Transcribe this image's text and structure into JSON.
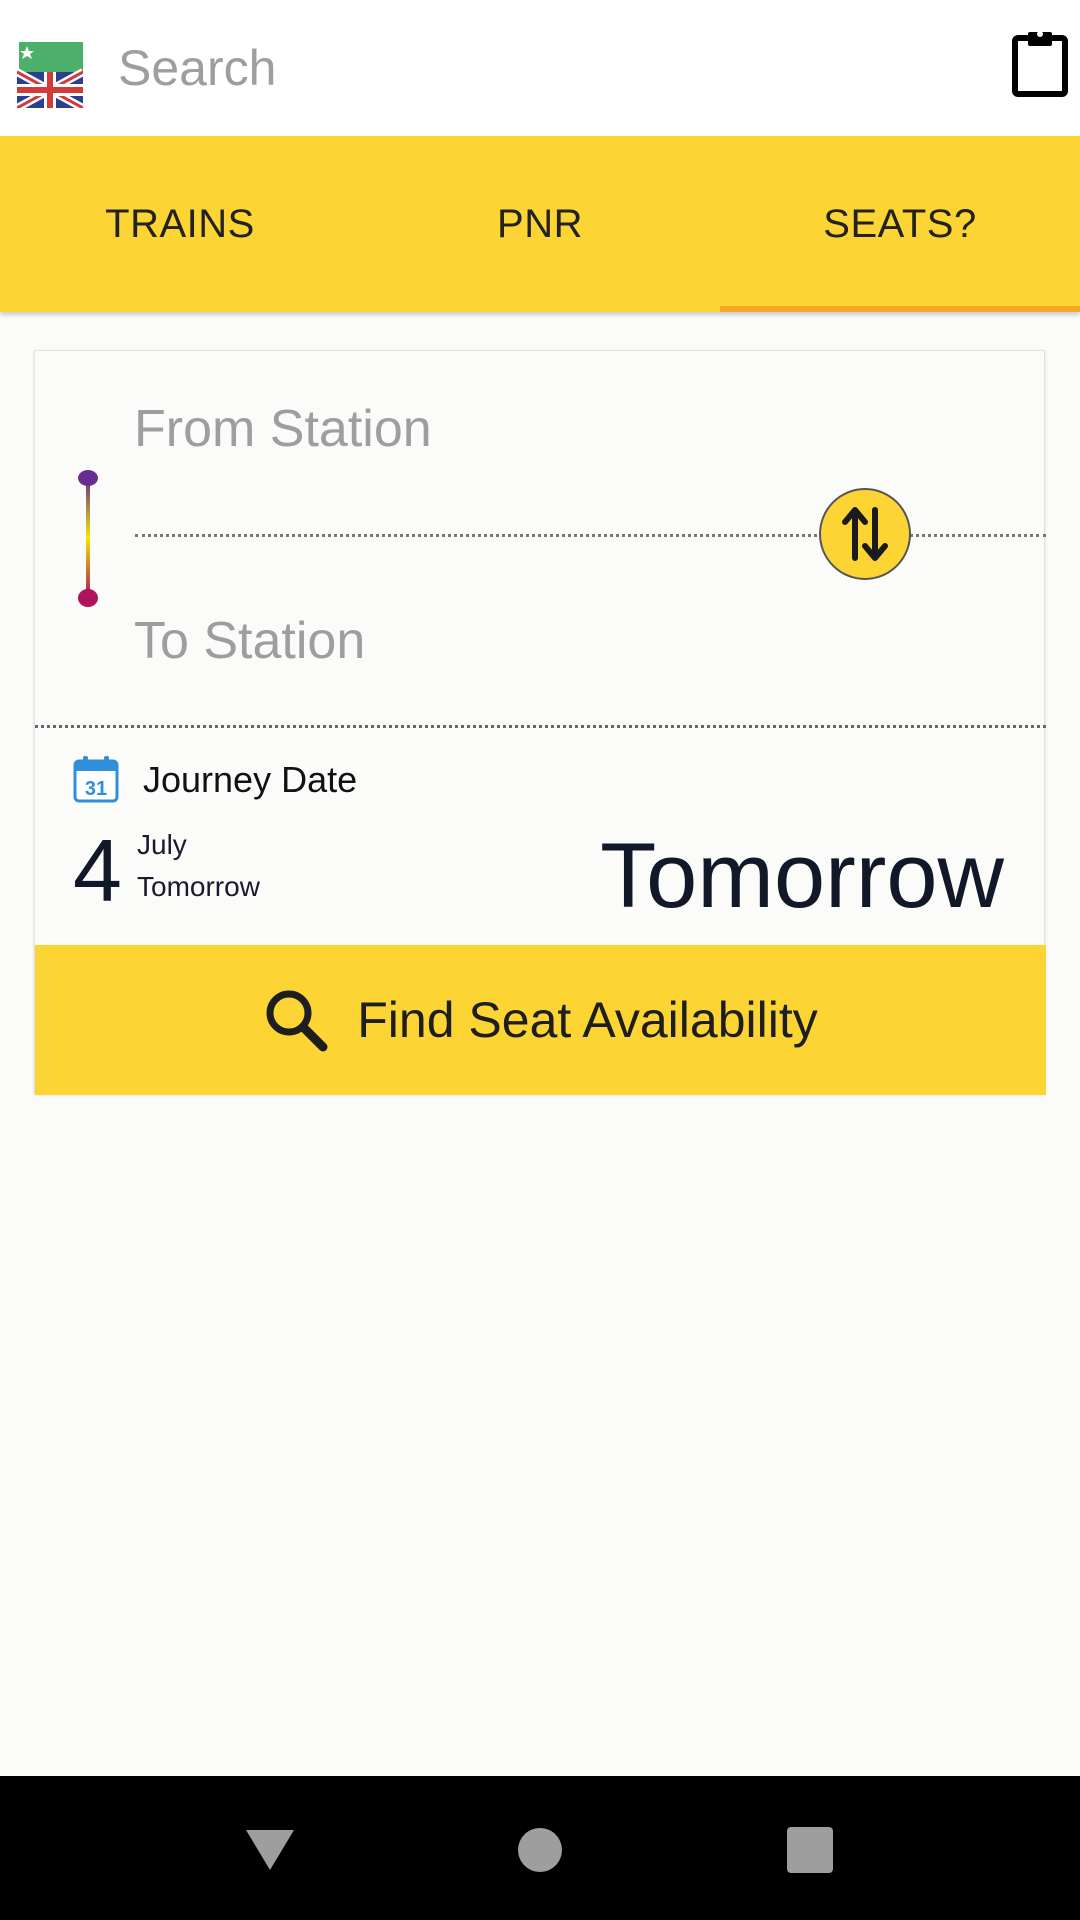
{
  "app_bar": {
    "search_placeholder": "Search",
    "language_icon": "uk-flag-language-icon",
    "clipboard_icon": "clipboard-icon"
  },
  "tabs": [
    {
      "label": "TRAINS",
      "selected": false
    },
    {
      "label": "PNR",
      "selected": false
    },
    {
      "label": "SEATS?",
      "selected": true
    }
  ],
  "route": {
    "from_placeholder": "From Station",
    "to_placeholder": "To Station",
    "swap_icon": "swap-vertical-icon"
  },
  "journey": {
    "label": "Journey Date",
    "calendar_icon_text": "31",
    "day": "4",
    "month": "July",
    "relative": "Tomorrow",
    "relative_large": "Tomorrow"
  },
  "action": {
    "label": "Find Seat Availability",
    "icon": "search-icon"
  },
  "colors": {
    "accent_yellow": "#fcd535",
    "tab_indicator": "#f5a623",
    "route_start_dot": "#6a2c91",
    "route_end_dot": "#b0125b"
  },
  "system_nav": [
    "back",
    "home",
    "recents"
  ]
}
